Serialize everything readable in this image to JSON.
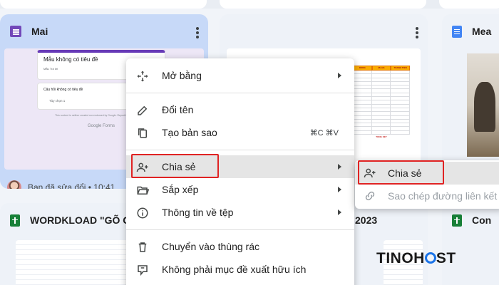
{
  "cards": {
    "top_left": {
      "title": "Mai",
      "modified": "Bạn đã sửa đổi • 10:41"
    },
    "top_right": {
      "title": "Mea"
    },
    "bottom_left": {
      "title": "WORDKLOAD \"GÕ CH"
    },
    "bottom_mid": {
      "title": "2023"
    },
    "bottom_right": {
      "title": "Con"
    }
  },
  "form_preview": {
    "title": "Mẫu không có tiêu đề",
    "subtitle": "Mẫu Trả lời",
    "question": "Câu hỏi không có tiêu đề",
    "option": "Tùy chọn 1",
    "footer": "This content is neither created nor endorsed by Google. Report Abuse · Terms of Service",
    "logo": "Google Forms"
  },
  "sheet_preview": {
    "headers": [
      "DONG",
      "Month",
      "THANH TIEN"
    ],
    "total_label": "TONG KET"
  },
  "context_menu": {
    "items": [
      {
        "label": "Mở bằng",
        "icon": "move-arrows-icon",
        "submenu": true
      },
      {
        "label": "Đổi tên",
        "icon": "pencil-icon"
      },
      {
        "label": "Tạo bản sao",
        "icon": "copy-icon",
        "shortcut": "⌘C ⌘V"
      },
      {
        "label": "Chia sẻ",
        "icon": "person-add-icon",
        "submenu": true
      },
      {
        "label": "Sắp xếp",
        "icon": "folder-open-icon",
        "submenu": true
      },
      {
        "label": "Thông tin về tệp",
        "icon": "info-icon",
        "submenu": true
      },
      {
        "label": "Chuyển vào thùng rác",
        "icon": "trash-icon"
      },
      {
        "label": "Không phải mục đề xuất hữu ích",
        "icon": "thumb-down-feedback-icon"
      }
    ]
  },
  "share_submenu": {
    "items": [
      {
        "label": "Chia sẻ",
        "icon": "person-add-icon"
      },
      {
        "label": "Sao chép đường liên kết",
        "icon": "link-icon",
        "disabled": true
      }
    ]
  },
  "watermark": {
    "part1": "TINO",
    "part2": "H",
    "part3": "ST"
  },
  "colors": {
    "highlight": "#e02323",
    "selected_card": "#c7d9f8",
    "forms": "#7248b9",
    "docs": "#4285f4",
    "sheets": "#188038"
  }
}
